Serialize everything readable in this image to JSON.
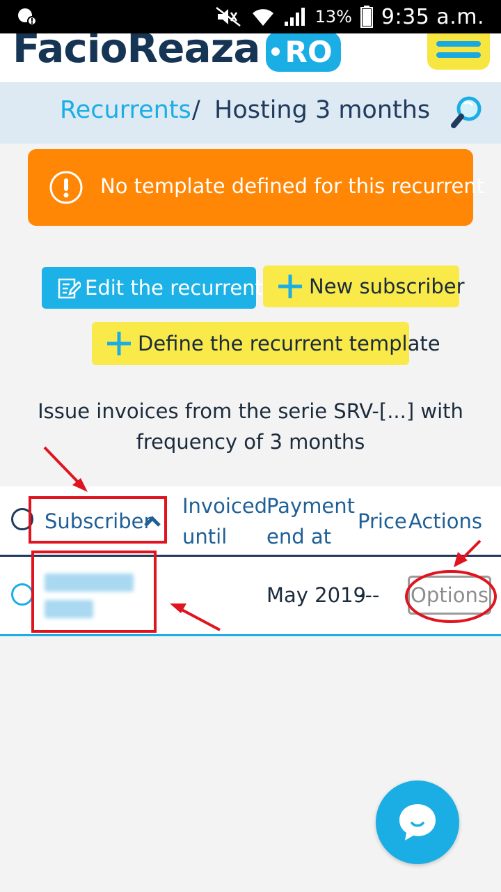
{
  "status_bar": {
    "battery_percent": "13%",
    "time": "9:35 a.m."
  },
  "header": {
    "logo_text": "FacioReaza",
    "logo_badge": "RO",
    "menu_icon": "hamburger-icon"
  },
  "breadcrumb": {
    "parent": "Recurrents",
    "separator": "/",
    "current": "Hosting 3 months",
    "search_icon": "search-icon"
  },
  "alert": {
    "icon": "exclamation-circle-icon",
    "message": "No template defined for this recurrent",
    "color": "#ff8705"
  },
  "actions": {
    "edit_label": "Edit the recurrent",
    "new_subscriber_label": "New subscriber",
    "define_template_label": "Define the recurrent template"
  },
  "description": {
    "line1": "Issue invoices from the serie SRV-[...] with",
    "line2": "frequency of 3 months"
  },
  "table": {
    "columns": {
      "subscriber": "Subscriber",
      "invoiced_until_1": "Invoiced",
      "invoiced_until_2": "until",
      "payment_end_1": "Payment",
      "payment_end_2": "end at",
      "price": "Price",
      "actions": "Actions"
    },
    "rows": [
      {
        "subscriber": "",
        "invoiced_until": "",
        "payment_end_at": "May 2019",
        "price": "---",
        "action_label": "Options"
      }
    ]
  },
  "colors": {
    "accent_blue": "#1aaee5",
    "accent_yellow": "#f9ea4a",
    "navy": "#1f3a5c",
    "annotation_red": "#e0141e"
  }
}
